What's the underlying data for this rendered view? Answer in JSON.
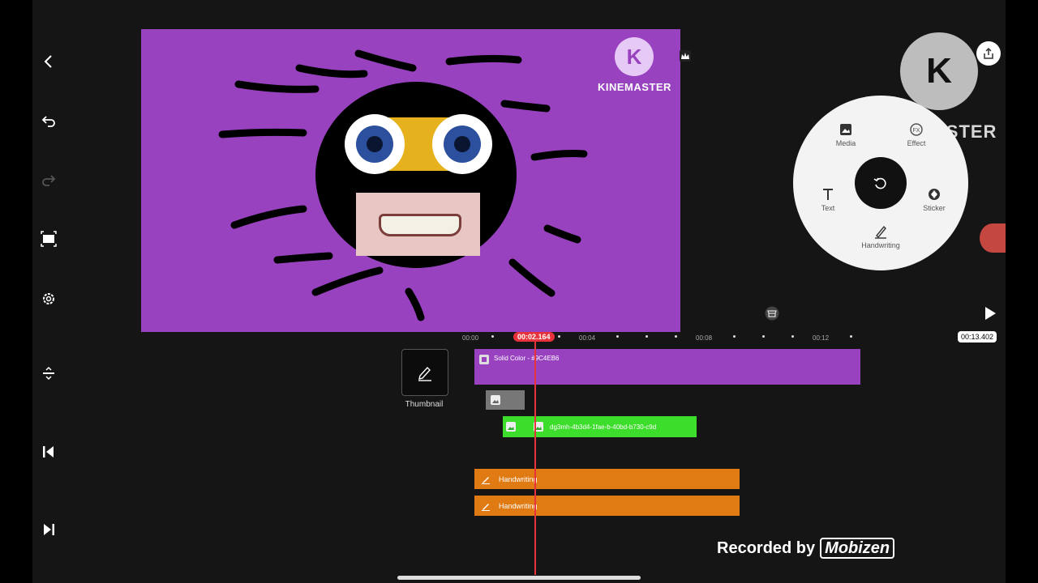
{
  "sidebar": {
    "back_icon": "chevron-left-icon",
    "undo_icon": "undo-icon",
    "redo_icon": "redo-icon",
    "capture_icon": "capture-frame-icon",
    "settings_icon": "gear-icon",
    "track_expand_icon": "expand-tracks-icon",
    "skip_start_icon": "skip-start-icon",
    "skip_end_icon": "skip-end-icon"
  },
  "preview": {
    "background_color": "#9842c0",
    "watermark_letter": "K",
    "watermark_text": "KINEMASTER"
  },
  "floating_logo": {
    "letter": "K",
    "wordmark": "KINEMASTER"
  },
  "radial_menu": {
    "media_label": "Media",
    "effect_label": "Effect",
    "text_label": "Text",
    "sticker_label": "Sticker",
    "handwriting_label": "Handwriting"
  },
  "timeline": {
    "current_time": "00:02.164",
    "duration": "00:13.402",
    "ruler_labels": [
      "00:00",
      "00:04",
      "00:08",
      "00:12"
    ],
    "thumbnail_label": "Thumbnail",
    "tracks": [
      {
        "type": "solid",
        "label": "Solid Color - #9C4EB6",
        "color": "#9842c0"
      },
      {
        "type": "image",
        "label": "",
        "color": "#777777"
      },
      {
        "type": "image",
        "label": "dg3mh-4b3d4-1fae-b-40bd-b730-c9d",
        "color": "#3ddd2b"
      },
      {
        "type": "handwriting",
        "label": "Handwriting",
        "color": "#e07a12"
      },
      {
        "type": "handwriting",
        "label": "Handwriting",
        "color": "#e07a12"
      }
    ]
  },
  "overlay": {
    "recorded_by": "Recorded by",
    "brand": "Mobizen"
  }
}
